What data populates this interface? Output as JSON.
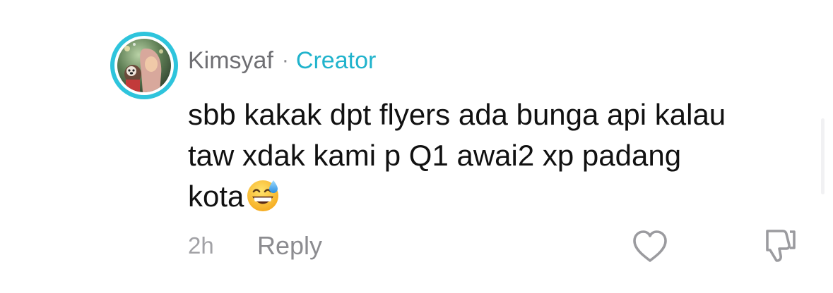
{
  "comment": {
    "username": "Kimsyaf",
    "separator": "·",
    "creator_badge": "Creator",
    "text_lines": [
      "sbb kakak dpt flyers ada bunga api kalau",
      "taw xdak kami p Q1 awai2 xp padang",
      "kota"
    ],
    "emoji": "grinning-face-with-sweat",
    "timestamp": "2h",
    "reply_label": "Reply"
  },
  "icons": {
    "like": "heart-outline-icon",
    "dislike": "thumbs-down-outline-icon"
  },
  "colors": {
    "avatar_ring": "#2ec4dc",
    "creator_label": "#20b3cc",
    "username": "#6f6f73",
    "text": "#111111",
    "muted": "#a2a2a6"
  }
}
